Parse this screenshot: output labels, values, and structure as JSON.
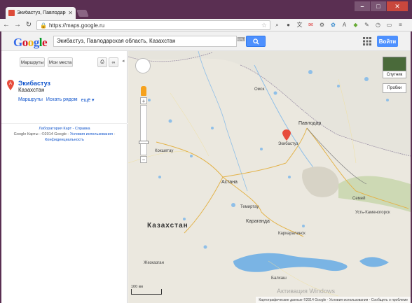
{
  "browser": {
    "tab_title": "Экибастуз, Павлодарская о",
    "url": "https://maps.google.ru"
  },
  "maps": {
    "search_value": "Экибастуз, Павлодарская область, Казахстан",
    "signin_label": "Войти",
    "panel": {
      "routes_button": "Маршруты",
      "my_places_button": "Мои места",
      "result_title": "Экибастуз",
      "result_subtitle": "Казахстан",
      "result_links": [
        "Маршруты",
        "Искать рядом",
        "ещё ▾"
      ],
      "footer_line1": "Лаборатория Карт - Справка",
      "footer_line2_prefix": "Google Карты - ©2014 Google - ",
      "footer_terms": "Условия использования",
      "footer_privacy": "Конфиденциальность"
    },
    "map_controls": {
      "satellite_label": "Спутник",
      "traffic_label": "Пробки"
    },
    "map_labels": {
      "country": "Казахстан",
      "city_astana": "Астана",
      "city_pavlodar": "Павлодар",
      "city_ekibastuz": "Экибастуз",
      "city_karaganda": "Караганда",
      "city_temirtau": "Темиртау",
      "city_ust_kamenogorsk": "Усть-Каменогорск",
      "city_semey": "Семей",
      "city_omsk": "Омск",
      "city_kokshetau": "Кокшетау",
      "city_karkaralinsk": "Каркаралинск",
      "city_balkhash": "Балхаш",
      "city_zhezkazgan": "Жезказган"
    },
    "scale_label": "100 км",
    "footer_text": "Картографические данные ©2014 Google - Условия использования - Сообщить о проблеме",
    "watermark": "Активация Windows"
  }
}
